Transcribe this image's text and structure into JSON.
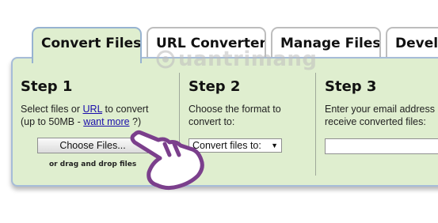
{
  "tabs": [
    {
      "label": "Convert Files",
      "active": true
    },
    {
      "label": "URL Converter",
      "active": false
    },
    {
      "label": "Manage Files",
      "active": false
    },
    {
      "label": "Develo",
      "active": false
    }
  ],
  "step1": {
    "title": "Step 1",
    "text_prefix": "Select files or ",
    "url_link": "URL",
    "text_suffix": " to convert",
    "line2_prefix": "(up to 50MB - ",
    "want_more_link": "want more",
    "line2_suffix": " ?)",
    "choose_button": "Choose Files...",
    "drop_hint": "or drag and drop files"
  },
  "step2": {
    "title": "Step 2",
    "line1": "Choose the format to",
    "line2": "convert to:",
    "select_value": "Convert files to:",
    "select_arrow": "▼"
  },
  "step3": {
    "title": "Step 3",
    "line1": "Enter your email address",
    "line2": "receive converted files:",
    "email_value": ""
  },
  "watermark": "uantrimang",
  "colors": {
    "panel_bg": "#dfeecf",
    "panel_border": "#a6bcd8",
    "link": "#1a0dab",
    "hand": "#7b3f8c"
  },
  "icons": [
    "cursor-hand-icon",
    "watermark-logo-icon"
  ]
}
